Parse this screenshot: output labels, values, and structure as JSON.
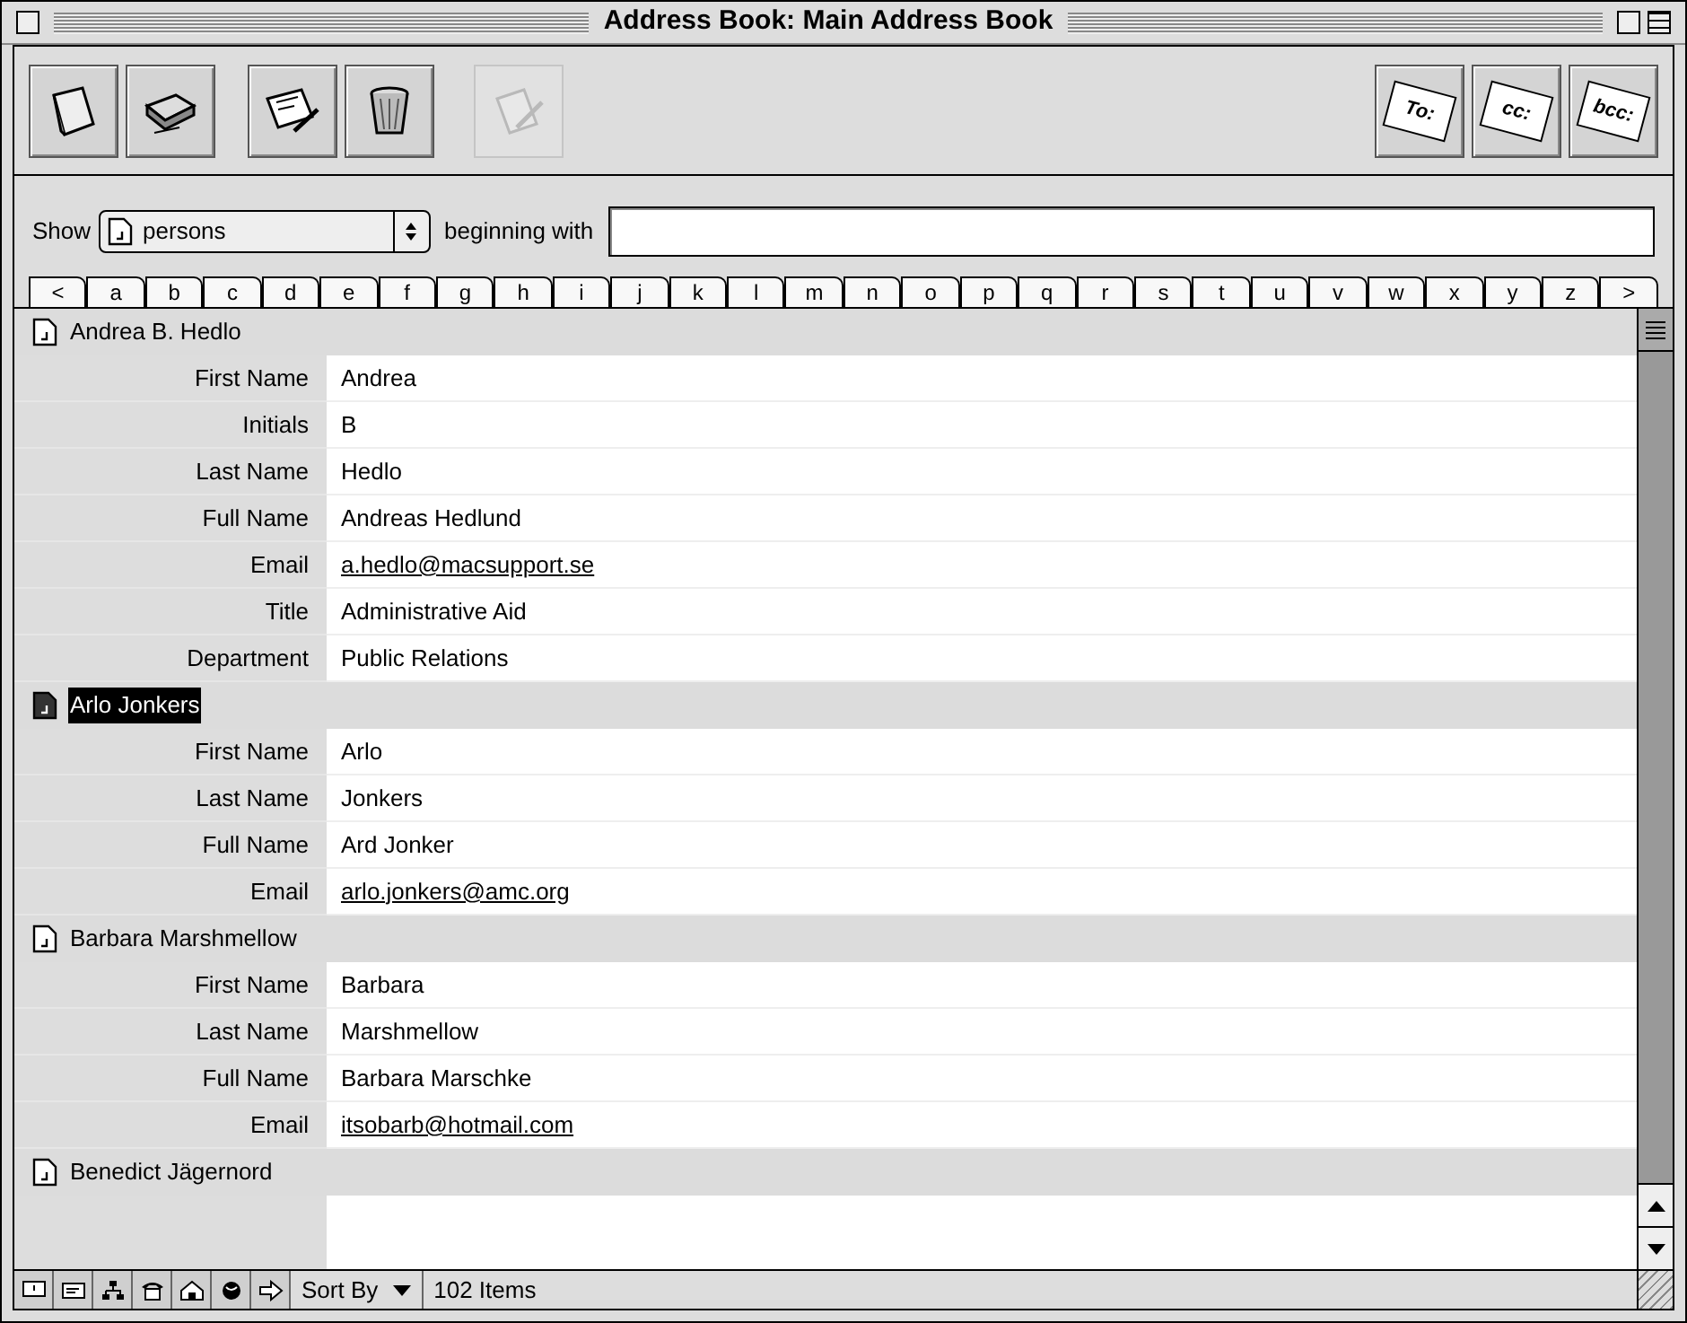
{
  "window": {
    "title": "Address Book: Main Address Book"
  },
  "toolbar": {
    "left": [
      {
        "kind": "book",
        "disabled": false
      },
      {
        "kind": "drive",
        "disabled": false
      },
      {
        "kind": "card",
        "disabled": false
      },
      {
        "kind": "trash",
        "disabled": false
      },
      {
        "kind": "note",
        "disabled": true
      }
    ],
    "right": [
      {
        "label": "To:"
      },
      {
        "label": "cc:"
      },
      {
        "label": "bcc:"
      }
    ]
  },
  "filter": {
    "show_label": "Show",
    "show_value": "persons",
    "beginning_label": "beginning with"
  },
  "letter_tabs": [
    "<",
    "a",
    "b",
    "c",
    "d",
    "e",
    "f",
    "g",
    "h",
    "i",
    "j",
    "k",
    "l",
    "m",
    "n",
    "o",
    "p",
    "q",
    "r",
    "s",
    "t",
    "u",
    "v",
    "w",
    "x",
    "y",
    "z",
    ">"
  ],
  "contacts": [
    {
      "name": "Andrea B. Hedlo",
      "selected": false,
      "fields": [
        {
          "label": "First Name",
          "value": "Andrea",
          "kind": "text"
        },
        {
          "label": "Initials",
          "value": "B",
          "kind": "text"
        },
        {
          "label": "Last Name",
          "value": "Hedlo",
          "kind": "text"
        },
        {
          "label": "Full Name",
          "value": "Andreas Hedlund",
          "kind": "text"
        },
        {
          "label": "Email",
          "value": "a.hedlo@macsupport.se",
          "kind": "email"
        },
        {
          "label": "Title",
          "value": "Administrative Aid",
          "kind": "text"
        },
        {
          "label": "Department",
          "value": "Public Relations",
          "kind": "text"
        }
      ]
    },
    {
      "name": "Arlo Jonkers",
      "selected": true,
      "fields": [
        {
          "label": "First Name",
          "value": "Arlo",
          "kind": "text"
        },
        {
          "label": "Last Name",
          "value": "Jonkers",
          "kind": "text"
        },
        {
          "label": "Full Name",
          "value": "Ard Jonker",
          "kind": "text"
        },
        {
          "label": "Email",
          "value": "arlo.jonkers@amc.org",
          "kind": "email"
        }
      ]
    },
    {
      "name": "Barbara Marshmellow",
      "selected": false,
      "fields": [
        {
          "label": "First Name",
          "value": "Barbara",
          "kind": "text"
        },
        {
          "label": "Last Name",
          "value": "Marshmellow",
          "kind": "text"
        },
        {
          "label": "Full Name",
          "value": "Barbara Marschke",
          "kind": "text"
        },
        {
          "label": "Email",
          "value": "itsobarb@hotmail.com",
          "kind": "email"
        }
      ]
    },
    {
      "name": "Benedict Jägernord",
      "selected": false
    }
  ],
  "status_bar": {
    "sort_label": "Sort By",
    "count": "102 Items"
  }
}
